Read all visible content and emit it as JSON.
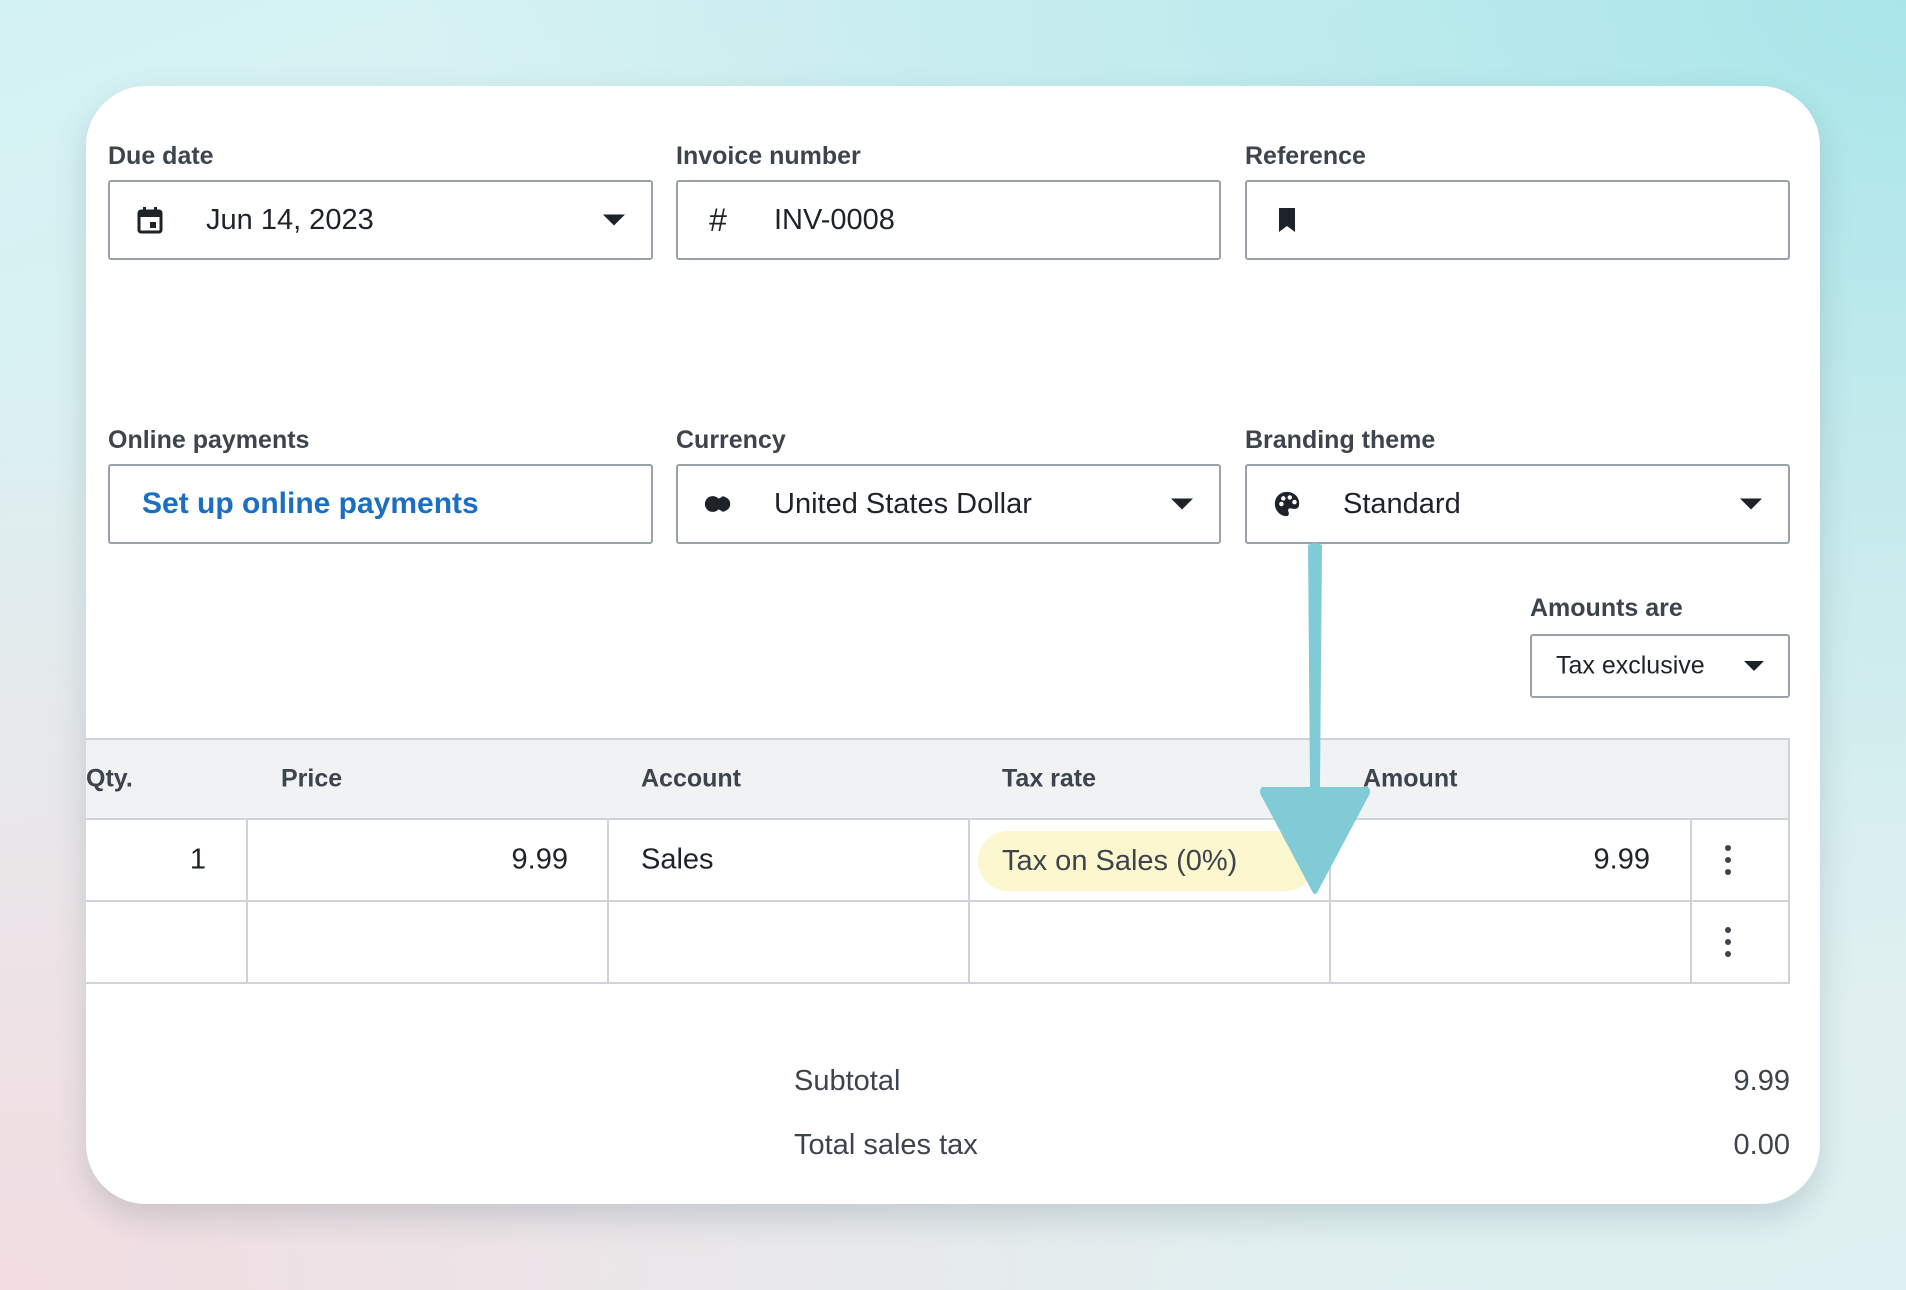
{
  "fields": {
    "due_date": {
      "label": "Due date",
      "value": "Jun 14, 2023",
      "icon": "calendar-icon"
    },
    "invoice_number": {
      "label": "Invoice number",
      "value": "INV-0008",
      "icon": "hash-icon"
    },
    "reference": {
      "label": "Reference",
      "value": "",
      "icon": "bookmark-icon"
    },
    "online_payments": {
      "label": "Online payments",
      "link": "Set up online payments"
    },
    "currency": {
      "label": "Currency",
      "value": "United States Dollar",
      "icon": "currency-icon"
    },
    "branding_theme": {
      "label": "Branding theme",
      "value": "Standard",
      "icon": "palette-icon"
    },
    "amounts_are": {
      "label": "Amounts are",
      "value": "Tax exclusive"
    }
  },
  "table": {
    "headers": [
      "Qty.",
      "Price",
      "Account",
      "Tax rate",
      "Amount"
    ],
    "rows": [
      {
        "qty": "1",
        "price": "9.99",
        "account": "Sales",
        "tax_rate": "Tax on Sales (0%)",
        "amount": "9.99"
      },
      {
        "qty": "",
        "price": "",
        "account": "",
        "tax_rate": "",
        "amount": ""
      }
    ]
  },
  "totals": {
    "subtotal_label": "Subtotal",
    "subtotal_value": "9.99",
    "tax_label": "Total sales tax",
    "tax_value": "0.00"
  },
  "colors": {
    "link": "#1b6fc3",
    "tax_pill_bg": "#fdf7cf",
    "annotation_arrow": "#80cbd6"
  }
}
